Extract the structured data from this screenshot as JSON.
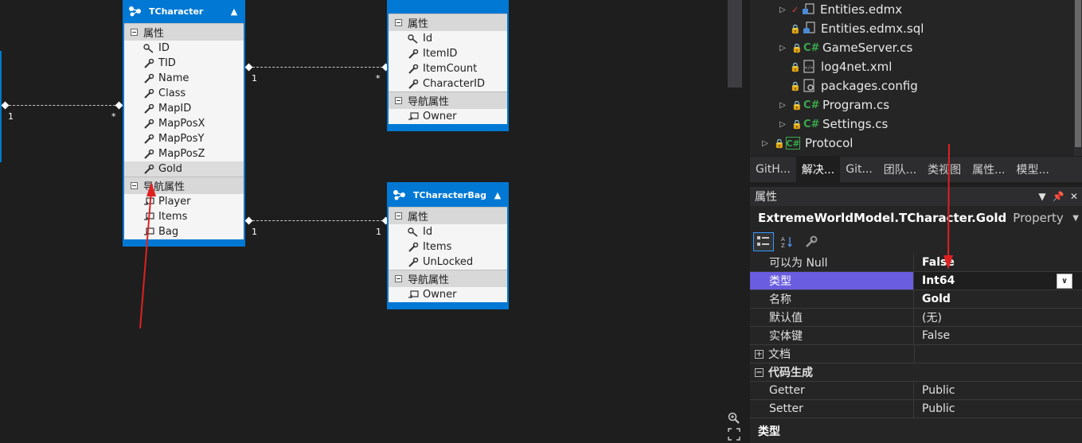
{
  "designer": {
    "entities": [
      {
        "title": "TCharacter",
        "sections": [
          {
            "header": "属性",
            "items": [
              "ID",
              "TID",
              "Name",
              "Class",
              "MapID",
              "MapPosX",
              "MapPosY",
              "MapPosZ",
              "Gold"
            ]
          },
          {
            "header": "导航属性",
            "items": [
              "Player",
              "Items",
              "Bag"
            ]
          }
        ]
      },
      {
        "title": "",
        "sections": [
          {
            "header": "属性",
            "items": [
              "Id",
              "ItemID",
              "ItemCount",
              "CharacterID"
            ]
          },
          {
            "header": "导航属性",
            "items": [
              "Owner"
            ]
          }
        ]
      },
      {
        "title": "TCharacterBag",
        "sections": [
          {
            "header": "属性",
            "items": [
              "Id",
              "Items",
              "UnLocked"
            ]
          },
          {
            "header": "导航属性",
            "items": [
              "Owner"
            ]
          }
        ]
      }
    ],
    "multiplicities": {
      "left_a": "1",
      "left_b": "*",
      "items_a": "1",
      "items_b": "*",
      "bag_a": "1",
      "bag_b": "1"
    },
    "selected_property": "Gold"
  },
  "solution_explorer": {
    "items": [
      {
        "label": "Entities.edmx",
        "icon": "edmx-icon",
        "expandable": true
      },
      {
        "label": "Entities.edmx.sql",
        "icon": "sql-file-icon",
        "expandable": false
      },
      {
        "label": "GameServer.cs",
        "icon": "csharp-file-icon",
        "expandable": true
      },
      {
        "label": "log4net.xml",
        "icon": "xml-file-icon",
        "expandable": false
      },
      {
        "label": "packages.config",
        "icon": "config-file-icon",
        "expandable": false
      },
      {
        "label": "Program.cs",
        "icon": "csharp-file-icon",
        "expandable": true
      },
      {
        "label": "Settings.cs",
        "icon": "csharp-file-icon",
        "expandable": true
      },
      {
        "label": "Protocol",
        "icon": "csharp-project-icon",
        "expandable": true
      }
    ]
  },
  "tabs": [
    "GitH...",
    "解决...",
    "Git...",
    "团队...",
    "类视图",
    "属性...",
    "模型..."
  ],
  "active_tab": "解决...",
  "properties": {
    "title": "属性",
    "object_name": "ExtremeWorldModel.TCharacter.Gold",
    "object_type": "Property",
    "rows": [
      {
        "name": "可以为 Null",
        "value": "False",
        "bold": true
      },
      {
        "name": "类型",
        "value": "Int64",
        "bold": true,
        "selected": true
      },
      {
        "name": "名称",
        "value": "Gold",
        "bold": true
      },
      {
        "name": "默认值",
        "value": "(无)",
        "bold": false
      },
      {
        "name": "实体键",
        "value": "False",
        "bold": false
      }
    ],
    "categories": [
      {
        "name": "文档",
        "symbol": "+"
      },
      {
        "name": "代码生成",
        "symbol": "−"
      }
    ],
    "codegen_rows": [
      {
        "name": "Getter",
        "value": "Public"
      },
      {
        "name": "Setter",
        "value": "Public"
      }
    ],
    "description_title": "类型"
  },
  "colors": {
    "entity_blue": "#0078d4",
    "selection_purple": "#6a5de0",
    "annotation_red": "#e02020"
  }
}
